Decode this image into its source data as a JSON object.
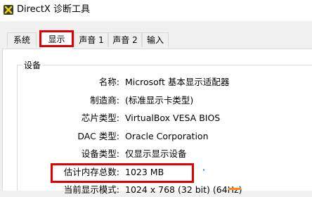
{
  "window": {
    "title": "DirectX 诊断工具",
    "icon": "directx-x-icon"
  },
  "tabs": [
    {
      "label": "系统",
      "active": false
    },
    {
      "label": "显示",
      "active": true
    },
    {
      "label": "声音 1",
      "active": false
    },
    {
      "label": "声音 2",
      "active": false
    },
    {
      "label": "输入",
      "active": false
    }
  ],
  "device": {
    "group_title": "设备",
    "fields": [
      {
        "label": "名称:",
        "value": "Microsoft 基本显示适配器"
      },
      {
        "label": "制造商:",
        "value": "(标准显示卡类型)"
      },
      {
        "label": "芯片类型:",
        "value": "VirtualBox VESA BIOS"
      },
      {
        "label": "DAC 类型:",
        "value": "Oracle Corporation"
      },
      {
        "label": "设备类型:",
        "value": "仅显示显示设备"
      },
      {
        "label": "估计内存总数:",
        "value": "1023 MB"
      },
      {
        "label": "当前显示模式:",
        "value": "1024 x 768 (32 bit) (64Hz)"
      }
    ]
  },
  "colors": {
    "highlight_red": "#e00000",
    "accent_orange": "#ff8a1c"
  }
}
